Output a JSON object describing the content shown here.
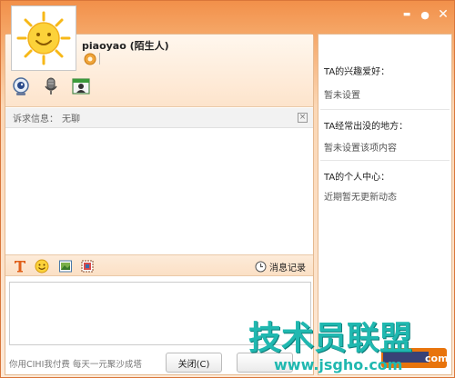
{
  "window": {
    "controls": {
      "minimize": "▬",
      "restore": "●",
      "close": "✕"
    }
  },
  "contact": {
    "name": "piaoyao (陌生人)",
    "avatar_icon": "sun-smiley-icon",
    "status_icon": "online-status-icon"
  },
  "tools": [
    "webcam-icon",
    "microphone-icon",
    "contact-card-icon"
  ],
  "request": {
    "label": "诉求信息：",
    "value": "无聊",
    "close": "×"
  },
  "toolbar": {
    "icons": [
      "font-icon",
      "emoji-icon",
      "image-icon",
      "screenshot-icon"
    ],
    "history_label": "消息记录"
  },
  "footer": {
    "promo": "你用CIHI我付费 每天一元聚沙成塔",
    "close_button": "关闭(C)",
    "send_button": ""
  },
  "profile": {
    "hobby_title": "TA的兴趣爱好：",
    "hobby_value": "暂未设置",
    "places_title": "TA经常出没的地方：",
    "places_value": "暂未设置该项内容",
    "center_title": "TA的个人中心：",
    "center_value": "近期暂无更新动态"
  },
  "watermark": {
    "main": "技术员联盟",
    "url": "www.jsgho.com",
    "tail": "com"
  },
  "colors": {
    "accent": "#f2904a",
    "watermark": "#20b8b0",
    "orange_bar": "#e8740c"
  }
}
